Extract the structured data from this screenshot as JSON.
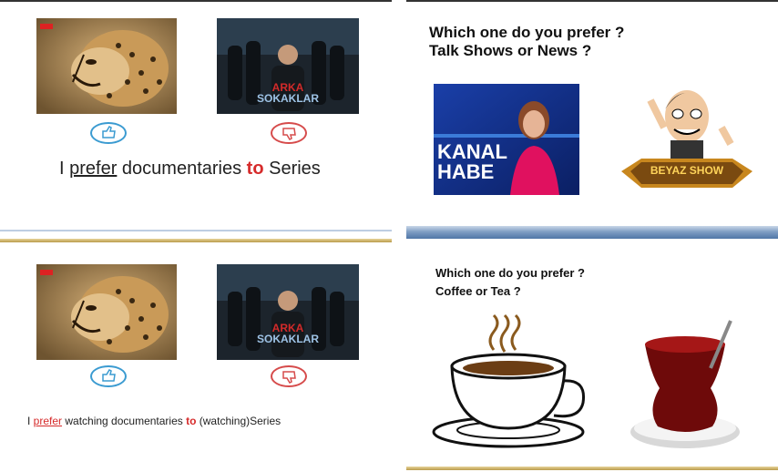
{
  "slide1": {
    "sentence": {
      "part1": "I ",
      "verb": "prefer",
      "part2": " documentaries ",
      "to": "to",
      "part3": " Series"
    },
    "series_poster_text": [
      "ARKA",
      "SOKAKLAR"
    ]
  },
  "slide2": {
    "title_line1": "Which one do you prefer ?",
    "title_line2": "Talk Shows or News ?",
    "news_text": [
      "KANAL",
      "HABE"
    ],
    "show_text": "BEYAZ SHOW"
  },
  "slide3": {
    "sentence": {
      "part1": "I ",
      "verb": "prefer",
      "part2": " watching  documentaries  ",
      "to": "to",
      "part3": " (watching)Series"
    },
    "series_poster_text": [
      "ARKA",
      "SOKAKLAR"
    ]
  },
  "slide4": {
    "title_line1": "Which one do you prefer ?",
    "title_line2": "Coffee or Tea ?"
  },
  "colors": {
    "like": "#3b9bd1",
    "dislike": "#d64b4b",
    "emphasis": "#d62b2b"
  },
  "icons": [
    "thumbs-up-icon",
    "thumbs-down-icon",
    "steam-icon"
  ]
}
